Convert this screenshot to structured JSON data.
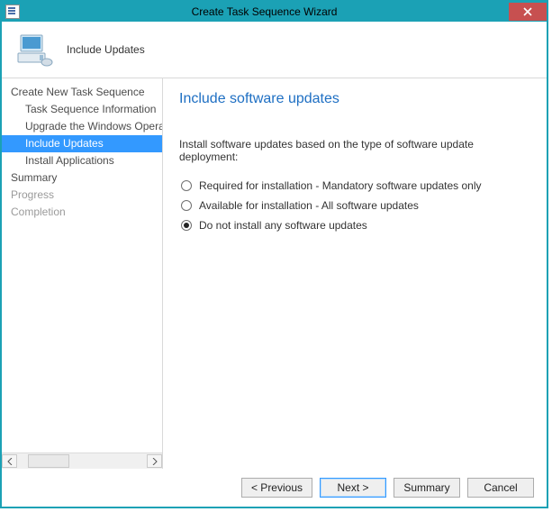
{
  "window": {
    "title": "Create Task Sequence Wizard"
  },
  "header": {
    "step_name": "Include Updates"
  },
  "sidebar": {
    "items": [
      {
        "label": "Create New Task Sequence",
        "level": "top",
        "state": "normal"
      },
      {
        "label": "Task Sequence Information",
        "level": "sub",
        "state": "normal"
      },
      {
        "label": "Upgrade the Windows Operating System",
        "level": "sub",
        "state": "normal"
      },
      {
        "label": "Include Updates",
        "level": "sub",
        "state": "selected"
      },
      {
        "label": "Install Applications",
        "level": "sub",
        "state": "normal"
      },
      {
        "label": "Summary",
        "level": "top",
        "state": "normal"
      },
      {
        "label": "Progress",
        "level": "top",
        "state": "disabled"
      },
      {
        "label": "Completion",
        "level": "top",
        "state": "disabled"
      }
    ]
  },
  "content": {
    "title": "Include software updates",
    "description": "Install software updates based on the type of software update deployment:",
    "options": [
      {
        "label": "Required for installation - Mandatory software updates only",
        "checked": false
      },
      {
        "label": "Available for installation - All software updates",
        "checked": false
      },
      {
        "label": "Do not install any software updates",
        "checked": true
      }
    ]
  },
  "footer": {
    "previous": "<  Previous",
    "next": "Next  >",
    "summary": "Summary",
    "cancel": "Cancel"
  }
}
